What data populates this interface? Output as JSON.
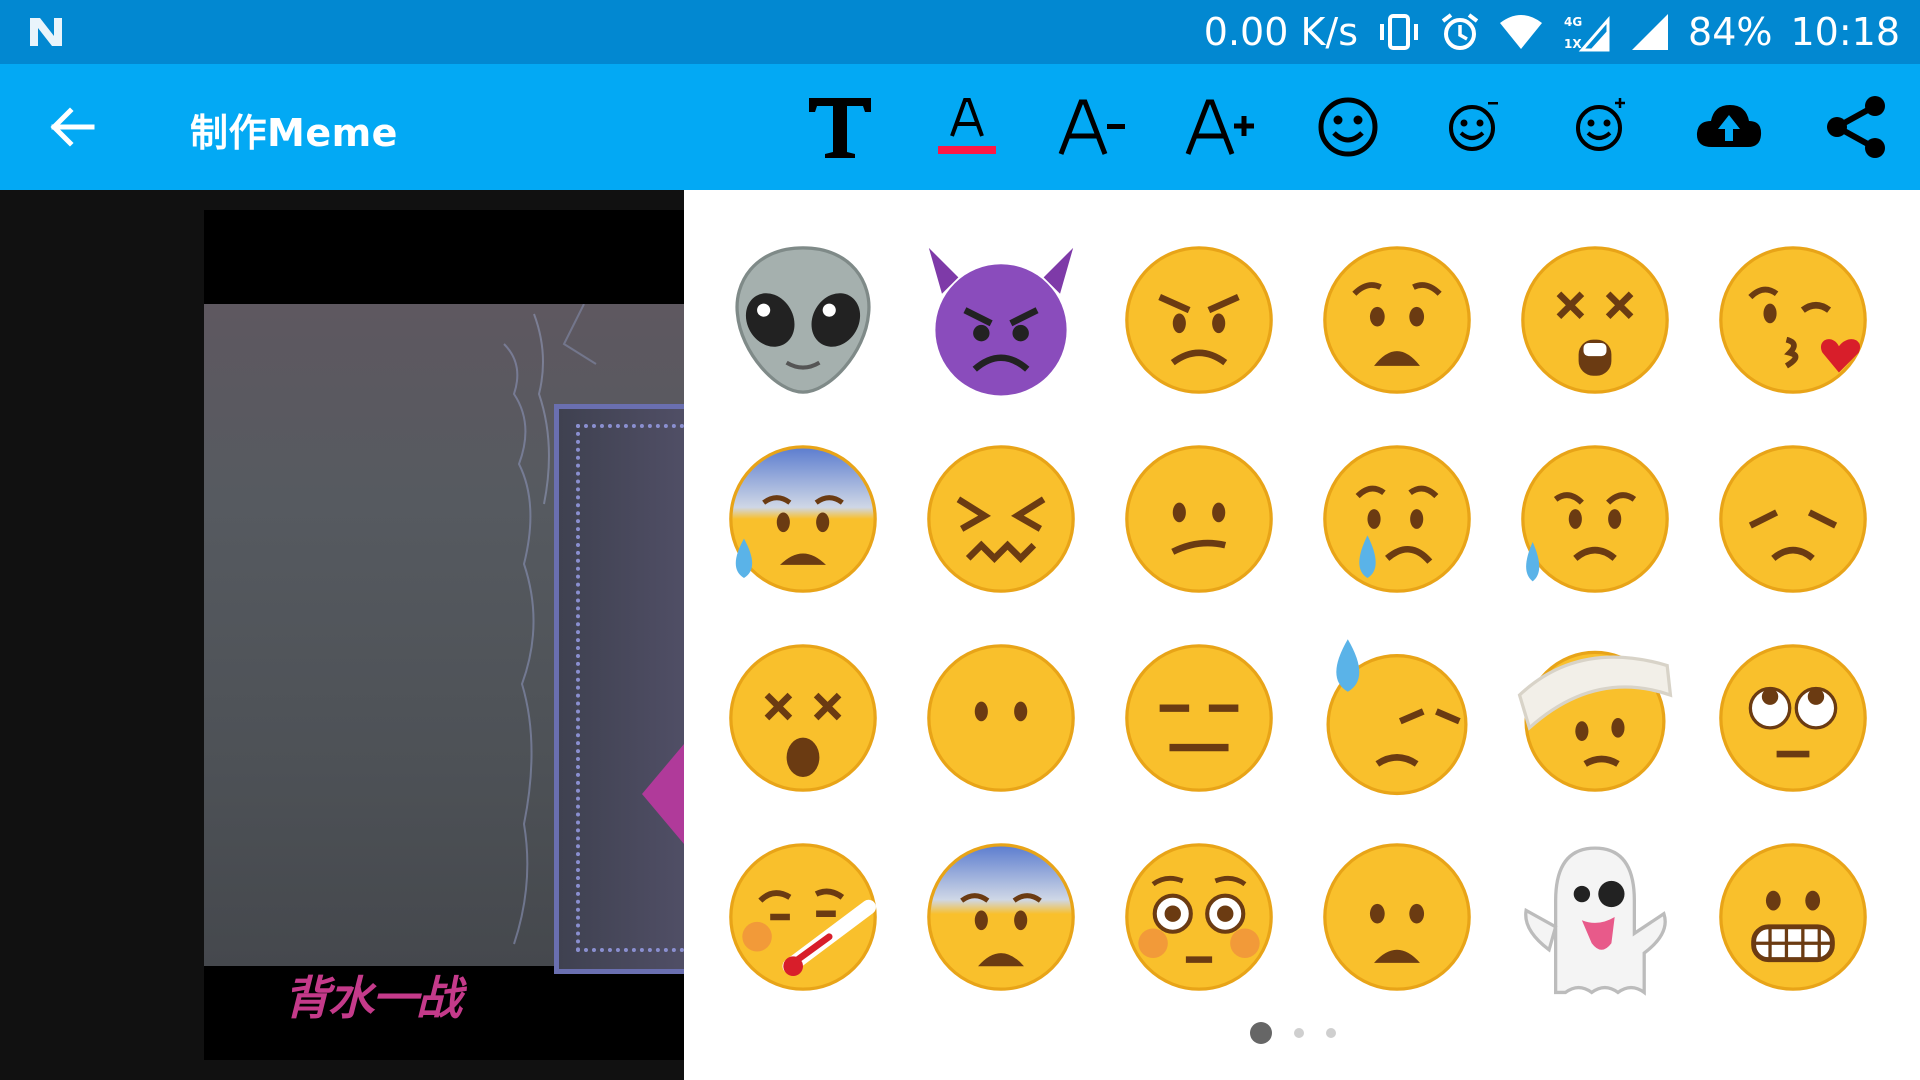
{
  "status": {
    "speed": "0.00 K/s",
    "network": "4G 1X",
    "battery": "84%",
    "time": "10:18"
  },
  "appbar": {
    "title": "制作Meme",
    "toolbar_icons": [
      "text-style-icon",
      "text-color-icon",
      "decrease-font-icon",
      "increase-font-icon",
      "emoji-icon",
      "emoji-minus-icon",
      "emoji-plus-icon",
      "cloud-upload-icon",
      "share-icon"
    ],
    "decrease_label": "A-",
    "increase_label": "A+",
    "text_color_underline": "#ff1744"
  },
  "canvas": {
    "caption": "背水一战"
  },
  "emoji_panel": {
    "emojis": [
      "alien",
      "smiling-imp",
      "angry",
      "anguished",
      "astonished",
      "kissing-heart",
      "cold-sweat",
      "confounded",
      "confused",
      "cry",
      "disappointed-relieved",
      "disappointed",
      "dizzy-face",
      "no-mouth",
      "expressionless",
      "sweat",
      "head-bandage",
      "rolling-eyes",
      "thermometer-face",
      "fearful",
      "flushed",
      "frowning",
      "ghost",
      "grimacing"
    ],
    "page_count": 3,
    "active_page": 1
  },
  "colors": {
    "status_bar": "#0288D1",
    "app_bar": "#03A9F4",
    "panel": "#ffffff"
  }
}
